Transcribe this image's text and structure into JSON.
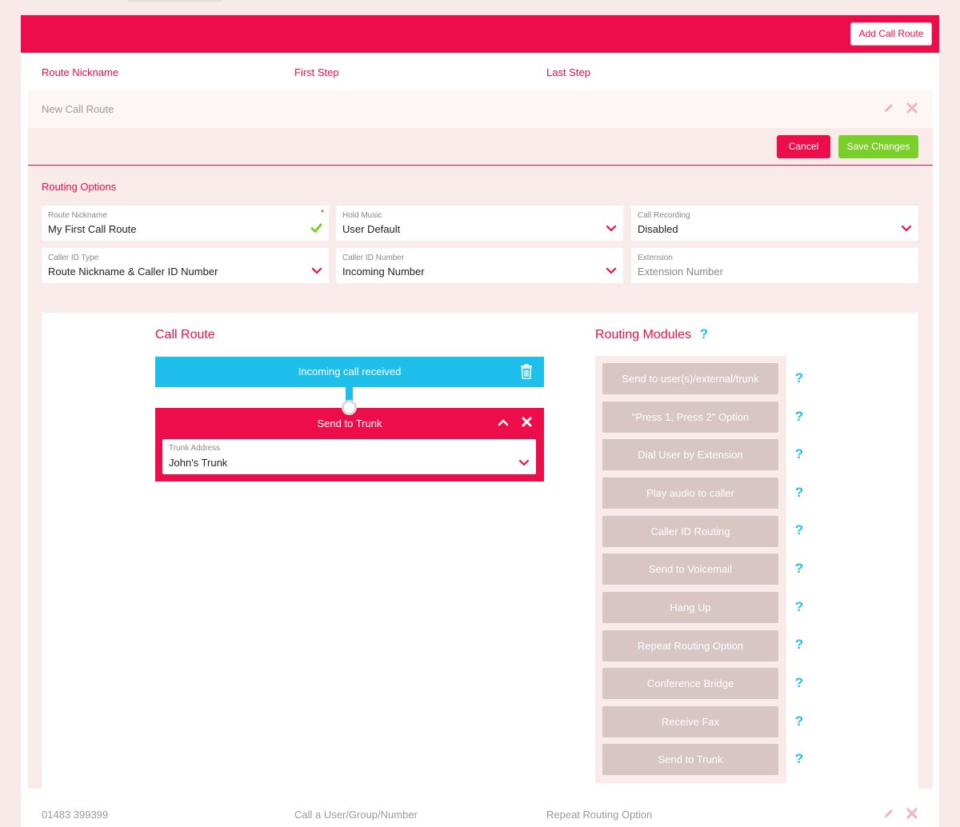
{
  "header": {
    "add_button": "Add Call Route"
  },
  "columns": {
    "nickname": "Route Nickname",
    "first_step": "First Step",
    "last_step": "Last Step"
  },
  "route_row": {
    "name": "New Call Route",
    "edit_icon": "pencil-icon",
    "delete_icon": "close-icon"
  },
  "actions": {
    "cancel": "Cancel",
    "save": "Save Changes"
  },
  "routing_options": {
    "title": "Routing Options",
    "route_nickname": {
      "label": "Route Nickname",
      "value": "My First Call Route",
      "required": "*"
    },
    "hold_music": {
      "label": "Hold Music",
      "value": "User Default"
    },
    "call_recording": {
      "label": "Call Recording",
      "value": "Disabled"
    },
    "caller_id_type": {
      "label": "Caller ID Type",
      "value": "Route Nickname & Caller ID Number"
    },
    "caller_id_number": {
      "label": "Caller ID Number",
      "value": "Incoming Number"
    },
    "extension": {
      "label": "Extension",
      "placeholder": "Extension Number"
    }
  },
  "call_route": {
    "title": "Call Route",
    "incoming": "Incoming call received",
    "trunk_block": {
      "title": "Send to Trunk",
      "field_label": "Trunk Address",
      "field_value": "John's Trunk"
    }
  },
  "routing_modules": {
    "title": "Routing Modules",
    "help": "?",
    "items": [
      {
        "label": "Send to user(s)/external/trunk",
        "help": "?"
      },
      {
        "label": "\"Press 1, Press 2\" Option",
        "help": "?"
      },
      {
        "label": "Dial User by Extension",
        "help": "?"
      },
      {
        "label": "Play audio to caller",
        "help": "?"
      },
      {
        "label": "Caller ID Routing",
        "help": "?"
      },
      {
        "label": "Send to Voicemail",
        "help": "?"
      },
      {
        "label": "Hang Up",
        "help": "?"
      },
      {
        "label": "Repeat Routing Option",
        "help": "?"
      },
      {
        "label": "Conference Bridge",
        "help": "?"
      },
      {
        "label": "Receive Fax",
        "help": "?"
      },
      {
        "label": "Send to Trunk",
        "help": "?"
      }
    ]
  },
  "bottom_row": {
    "number": "01483 399399",
    "first_step": "Call a User/Group/Number",
    "last_step": "Repeat Routing Option"
  },
  "colors": {
    "brand": "#ee0d4b",
    "accent_blue": "#1fbfeb",
    "success": "#7bcf2a",
    "module": "#d8c6c4"
  }
}
